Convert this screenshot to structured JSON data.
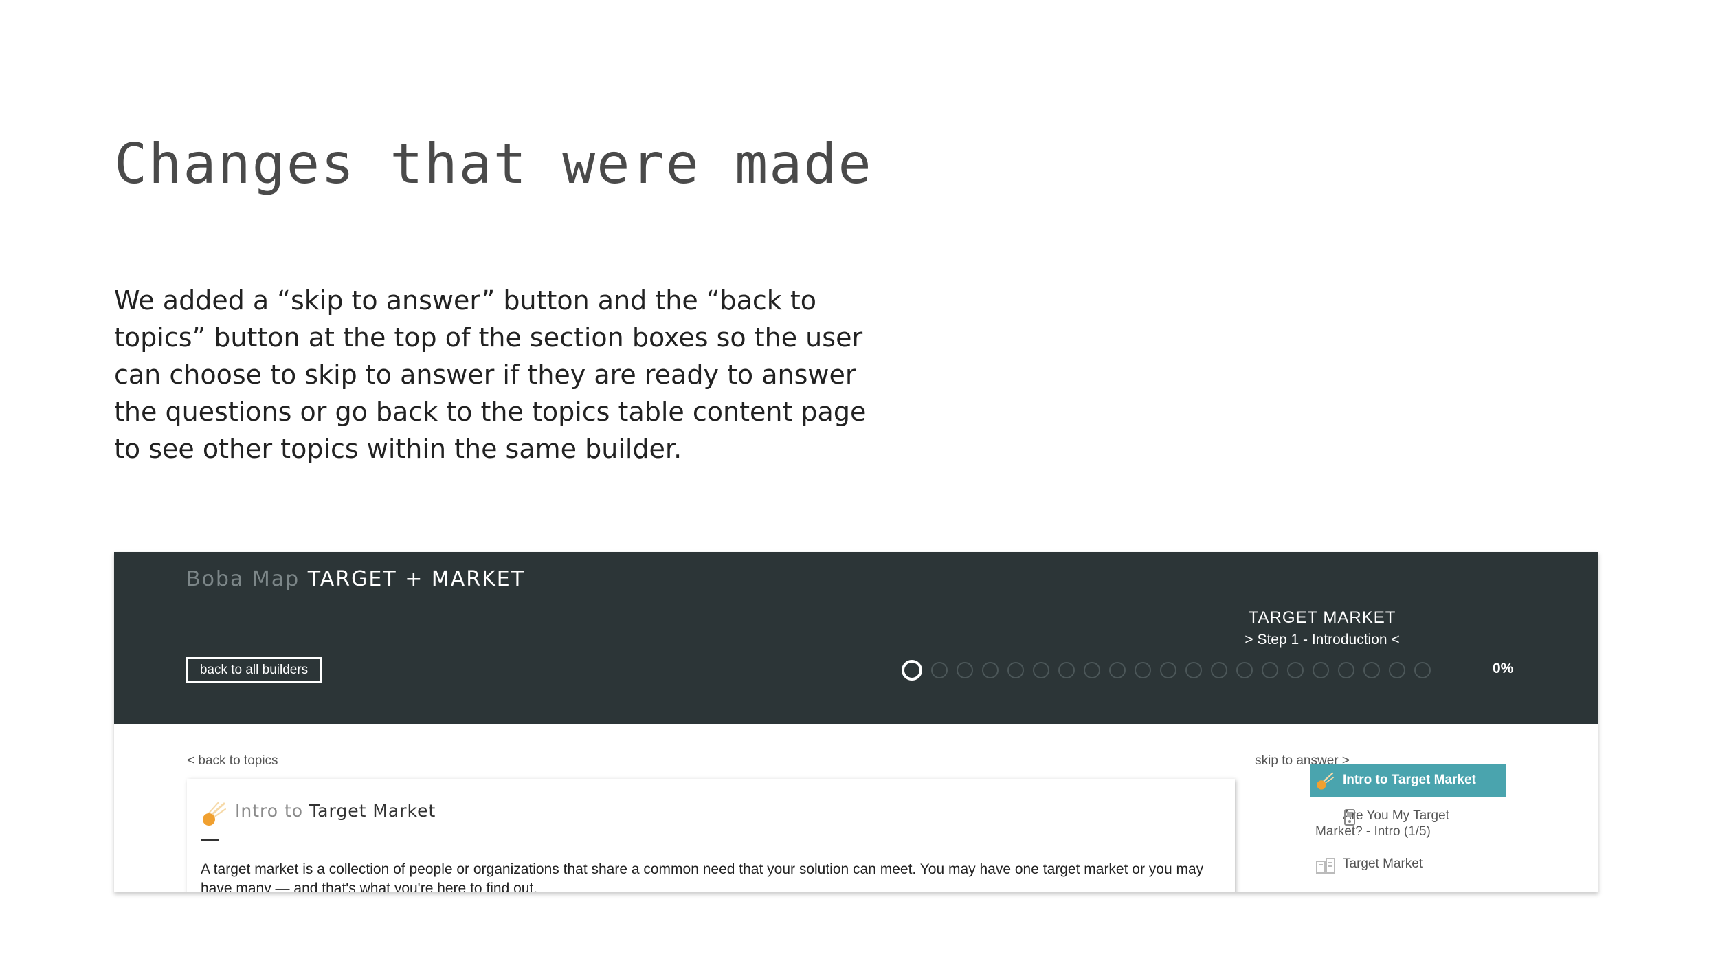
{
  "slide": {
    "title": "Changes that were made",
    "body": "We added a “skip to answer” button and the “back to topics” button at the top of the section boxes so the user can choose to skip to answer if they are ready to answer the questions or go back to the topics table content page to see other topics within the same builder."
  },
  "app": {
    "brand_name": "Boba Map",
    "product": "TARGET + MARKET",
    "back_all_builders": "back to all builders",
    "step_title": "TARGET MARKET",
    "step_subtitle": "> Step 1 - Introduction <",
    "progress": {
      "total_steps": 21,
      "current_step": 1,
      "percent_label": "0%"
    },
    "back_to_topics": "< back to topics",
    "skip_to_answer": "skip to answer >",
    "card": {
      "title_light": "Intro to",
      "title_dark": "Target Market",
      "text": "A target market is a collection of people or organizations that share a common need that your solution can meet. You may have one target market or you may have many — and that's what you're here to find out."
    },
    "side_nav": {
      "active": "Intro to Target Market",
      "item2": "Are You My Target Market? - Intro (1/5)",
      "item3": "Target Market"
    }
  },
  "colors": {
    "header_bg": "#2c3537",
    "accent": "#4aa4ae",
    "icon_orange": "#f0a030"
  },
  "icons": {
    "card_icon": "comet-icon",
    "nav_active_icon": "comet-icon",
    "nav_item2_icon": "device-icon",
    "nav_item3_icon": "buildings-icon"
  }
}
